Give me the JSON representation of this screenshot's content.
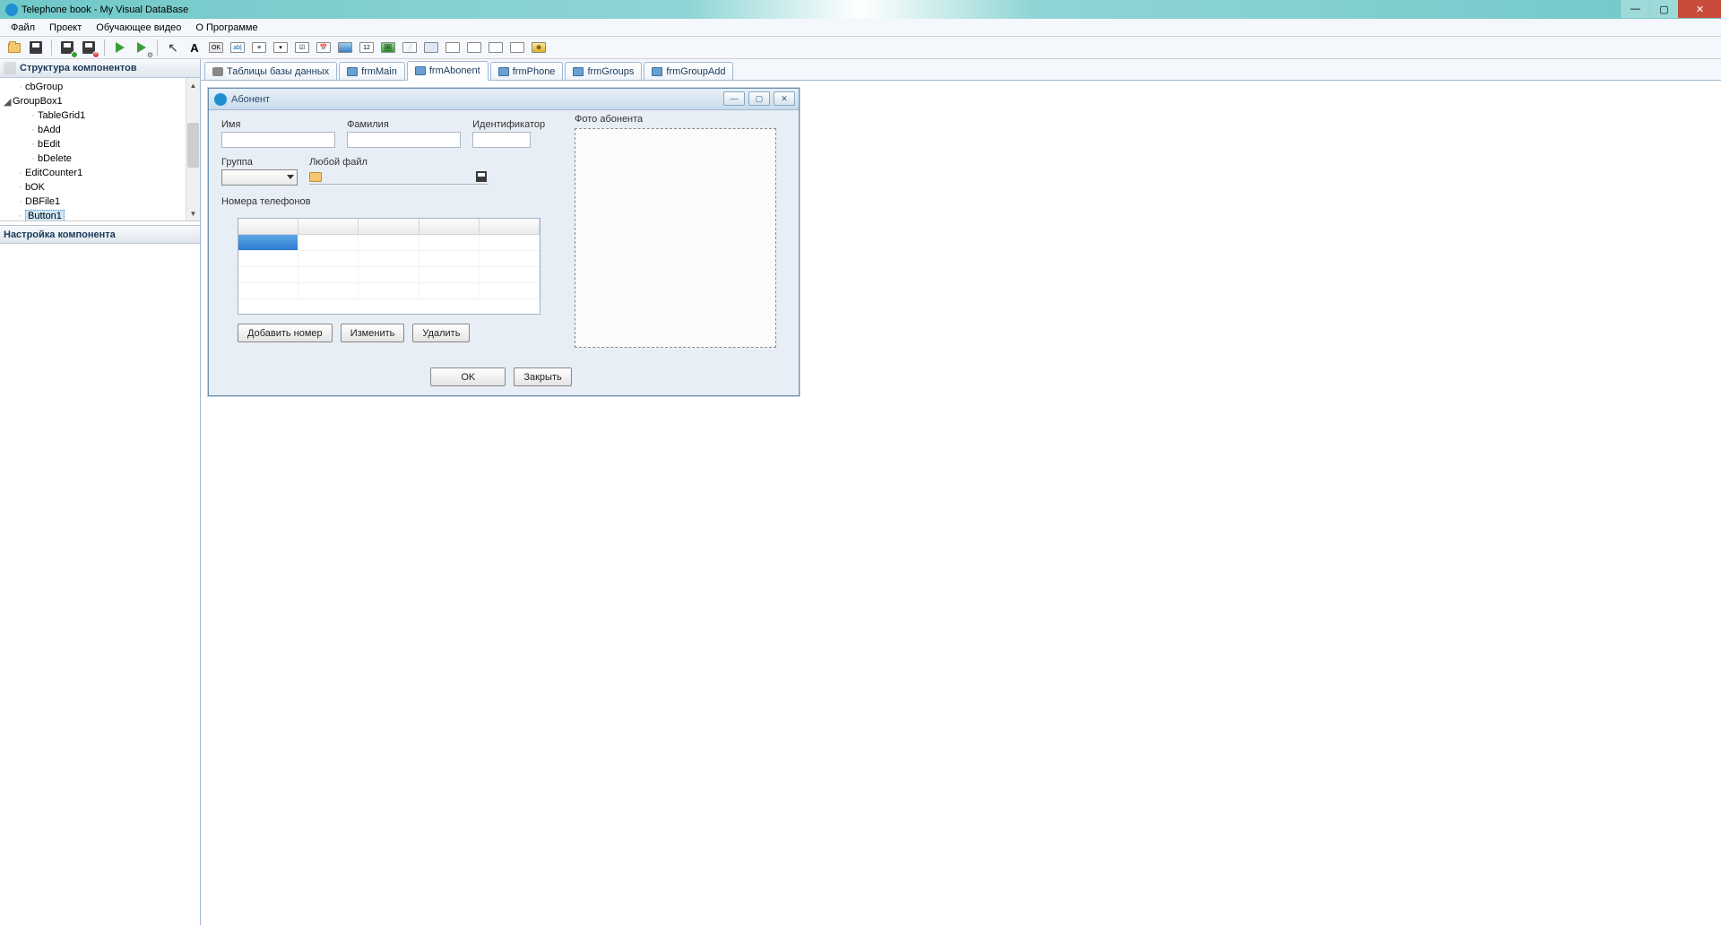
{
  "window": {
    "title": "Telephone book - My Visual DataBase"
  },
  "menu": {
    "file": "Файл",
    "project": "Проект",
    "tutorial": "Обучающее видео",
    "about": "О Программе"
  },
  "left": {
    "structure_header": "Структура компонентов",
    "settings_header": "Настройка компонента",
    "tree": {
      "cbGroup": "cbGroup",
      "GroupBox1": "GroupBox1",
      "TableGrid1": "TableGrid1",
      "bAdd": "bAdd",
      "bEdit": "bEdit",
      "bDelete": "bDelete",
      "EditCounter1": "EditCounter1",
      "bOK": "bOK",
      "DBFile1": "DBFile1",
      "Button1": "Button1"
    }
  },
  "tabs": {
    "tables": "Таблицы базы данных",
    "frmMain": "frmMain",
    "frmAbonent": "frmAbonent",
    "frmPhone": "frmPhone",
    "frmGroups": "frmGroups",
    "frmGroupAdd": "frmGroupAdd"
  },
  "abonent": {
    "title": "Абонент",
    "name": "Имя",
    "surname": "Фамилия",
    "identifier": "Идентификатор",
    "group": "Группа",
    "anyfile": "Любой файл",
    "photo": "Фото абонента",
    "phones": "Номера телефонов",
    "add_number": "Добавить номер",
    "edit": "Изменить",
    "delete": "Удалить",
    "ok": "OK",
    "close": "Закрыть"
  }
}
